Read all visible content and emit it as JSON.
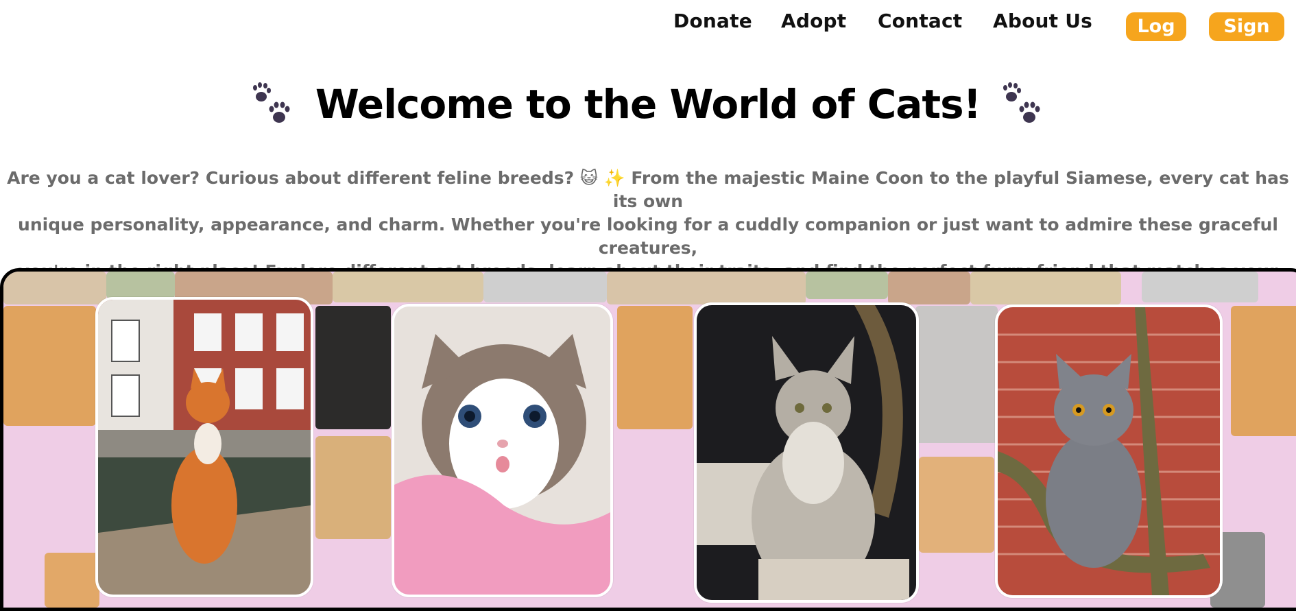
{
  "nav": {
    "links": [
      "Donate",
      "Adopt",
      "Contact",
      "About Us"
    ],
    "login_label": "Log in",
    "signup_label": "Sign Up"
  },
  "hero": {
    "title": "Welcome to the World of Cats!",
    "paw_icon": "paw-prints-icon",
    "intro_line1": "Are you a cat lover? Curious about different feline breeds? 😺 ✨ From the majestic Maine Coon to the playful Siamese, every cat has its own",
    "intro_line2": "unique personality, appearance, and charm. Whether you're looking for a cuddly companion or just want to admire these graceful creatures,",
    "intro_line3": "you're in the right place! Explore different cat breeds, learn about their traits, and find the perfect furry friend that matches your vibe. 🏠 💖"
  },
  "colors": {
    "accent": "#f6a51d",
    "gallery_bg": "#efcde6",
    "paw": "#3e3550",
    "intro_text": "#6b6b6b"
  },
  "gallery": {
    "cards": [
      {
        "name": "ginger-cat-photo"
      },
      {
        "name": "ragdoll-kitten-photo"
      },
      {
        "name": "maine-coon-photo"
      },
      {
        "name": "british-shorthair-photo"
      }
    ]
  }
}
